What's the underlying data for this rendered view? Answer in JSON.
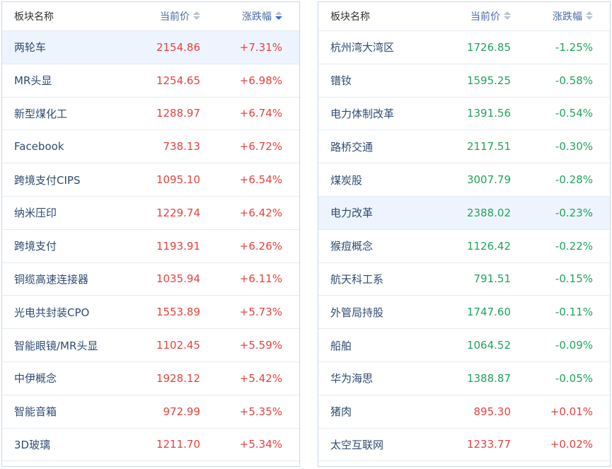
{
  "left": {
    "header": {
      "name": "板块名称",
      "price": "当前价",
      "chg": "涨跌幅"
    },
    "rows": [
      {
        "name": "两轮车",
        "price": "2154.86",
        "chg": "+7.31%"
      },
      {
        "name": "MR头显",
        "price": "1254.65",
        "chg": "+6.98%"
      },
      {
        "name": "新型煤化工",
        "price": "1288.97",
        "chg": "+6.74%"
      },
      {
        "name": "Facebook",
        "price": "738.13",
        "chg": "+6.72%"
      },
      {
        "name": "跨境支付CIPS",
        "price": "1095.10",
        "chg": "+6.54%"
      },
      {
        "name": "纳米压印",
        "price": "1229.74",
        "chg": "+6.42%"
      },
      {
        "name": "跨境支付",
        "price": "1193.91",
        "chg": "+6.26%"
      },
      {
        "name": "铜缆高速连接器",
        "price": "1035.94",
        "chg": "+6.11%"
      },
      {
        "name": "光电共封装CPO",
        "price": "1553.89",
        "chg": "+5.73%"
      },
      {
        "name": "智能眼镜/MR头显",
        "price": "1102.45",
        "chg": "+5.59%"
      },
      {
        "name": "中伊概念",
        "price": "1928.12",
        "chg": "+5.42%"
      },
      {
        "name": "智能音箱",
        "price": "972.99",
        "chg": "+5.35%"
      },
      {
        "name": "3D玻璃",
        "price": "1211.70",
        "chg": "+5.34%"
      }
    ]
  },
  "right": {
    "header": {
      "name": "板块名称",
      "price": "当前价",
      "chg": "涨跌幅"
    },
    "rows": [
      {
        "name": "杭州湾大湾区",
        "price": "1726.85",
        "chg": "-1.25%"
      },
      {
        "name": "镨钕",
        "price": "1595.25",
        "chg": "-0.58%"
      },
      {
        "name": "电力体制改革",
        "price": "1391.56",
        "chg": "-0.54%"
      },
      {
        "name": "路桥交通",
        "price": "2117.51",
        "chg": "-0.30%"
      },
      {
        "name": "煤炭股",
        "price": "3007.79",
        "chg": "-0.28%"
      },
      {
        "name": "电力改革",
        "price": "2388.02",
        "chg": "-0.23%"
      },
      {
        "name": "猴痘概念",
        "price": "1126.42",
        "chg": "-0.22%"
      },
      {
        "name": "航天科工系",
        "price": "791.51",
        "chg": "-0.15%"
      },
      {
        "name": "外管局持股",
        "price": "1747.60",
        "chg": "-0.11%"
      },
      {
        "name": "船舶",
        "price": "1064.52",
        "chg": "-0.09%"
      },
      {
        "name": "华为海思",
        "price": "1388.87",
        "chg": "-0.05%"
      },
      {
        "name": "猪肉",
        "price": "895.30",
        "chg": "+0.01%"
      },
      {
        "name": "太空互联网",
        "price": "1233.77",
        "chg": "+0.02%"
      }
    ]
  },
  "colors": {
    "up": "#e8413e",
    "down": "#20a45a",
    "highlight": "#eef4fd",
    "sort_active": "#2e6fd1"
  }
}
